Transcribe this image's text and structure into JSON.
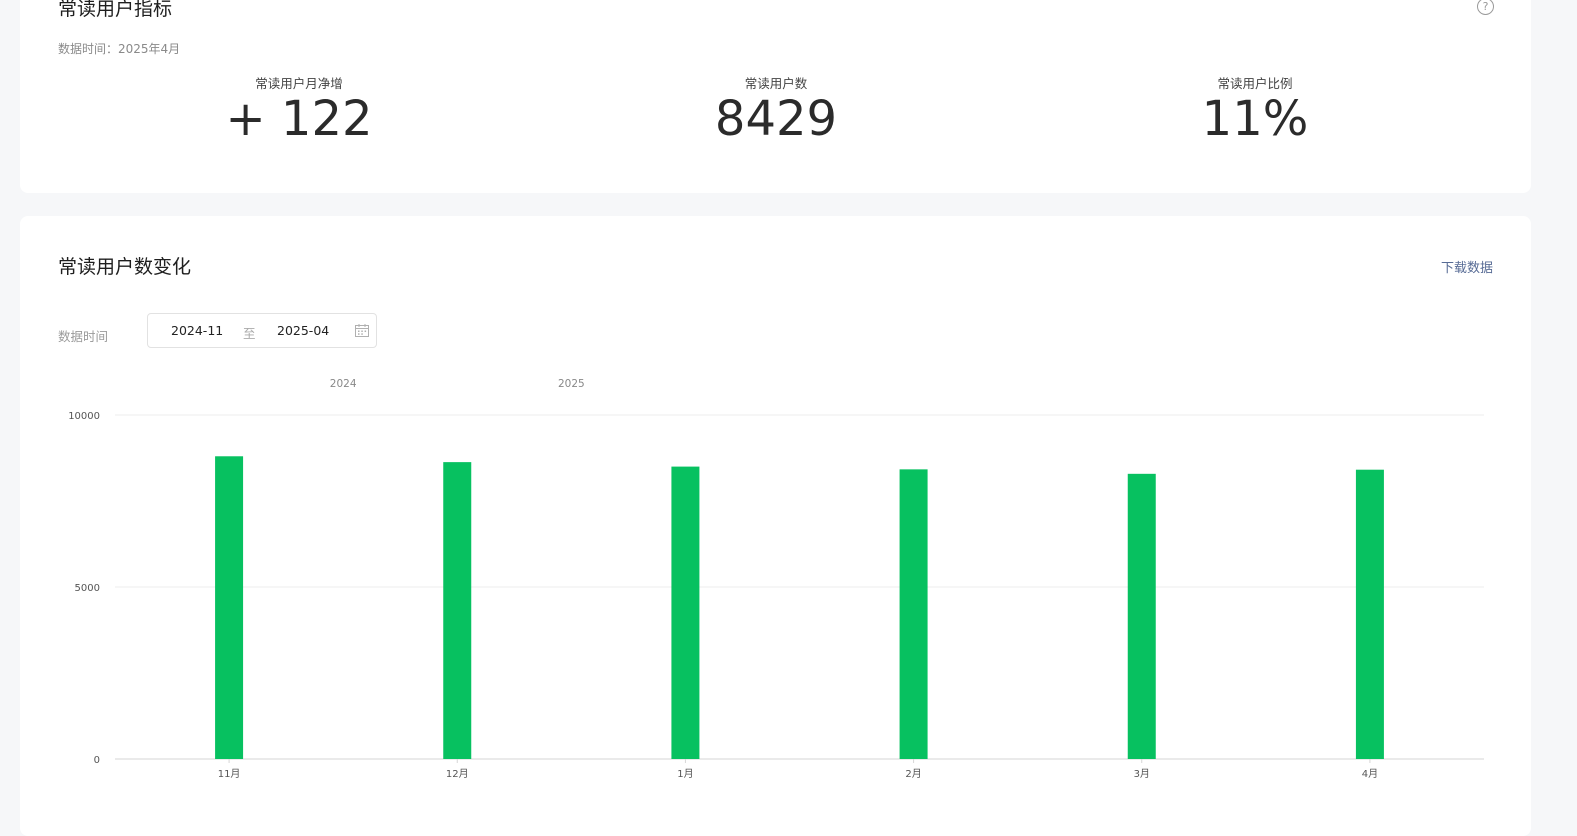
{
  "metrics_section": {
    "title": "常读用户指标",
    "help_glyph": "?",
    "data_time": "数据时间：2025年4月",
    "metrics": [
      {
        "label": "常读用户月净增",
        "value": "+ 122"
      },
      {
        "label": "常读用户数",
        "value": "8429"
      },
      {
        "label": "常读用户比例",
        "value": "11%"
      }
    ]
  },
  "trend_section": {
    "title": "常读用户数变化",
    "download_label": "下载数据",
    "range_label": "数据时间",
    "range_start": "2024-11",
    "range_separator": "至",
    "range_end": "2025-04",
    "calendar_icon": "calendar-icon"
  },
  "colors": {
    "bar": "#07c160",
    "grid": "#ececec",
    "link": "#576b95"
  },
  "chart_data": {
    "type": "bar",
    "categories": [
      "11月",
      "12月",
      "1月",
      "2月",
      "3月",
      "4月"
    ],
    "year_labels": [
      {
        "label": "2024",
        "category_offset": 1.0
      },
      {
        "label": "2025",
        "category_offset": 2.0
      }
    ],
    "values": [
      8800,
      8630,
      8500,
      8420,
      8290,
      8410
    ],
    "ylim": [
      0,
      10000
    ],
    "yticks": [
      0,
      5000,
      10000
    ],
    "grid": true,
    "legend": "none",
    "title": "",
    "xlabel": "",
    "ylabel": ""
  }
}
